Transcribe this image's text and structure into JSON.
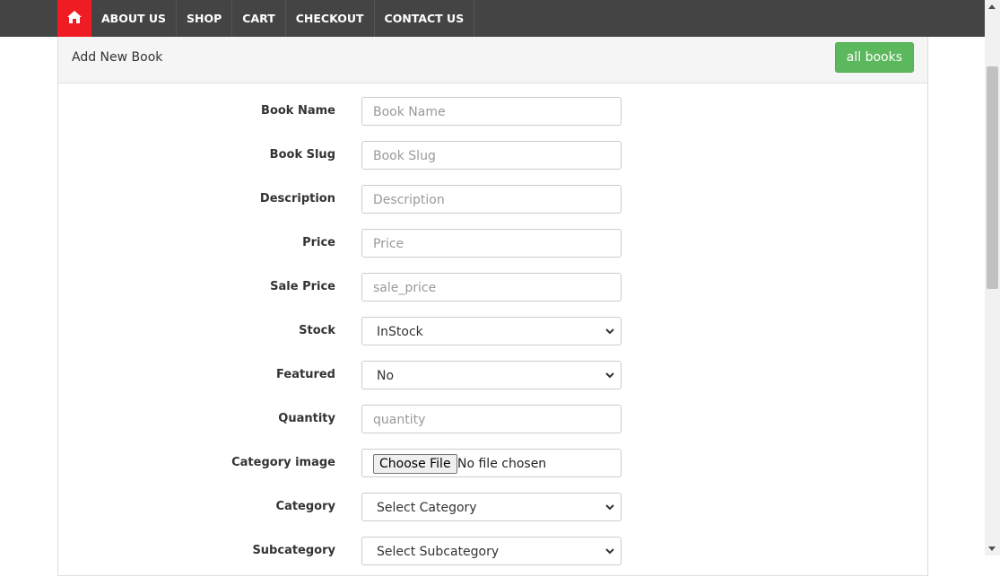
{
  "nav": {
    "home_icon": "home-icon",
    "items": [
      {
        "label": "ABOUT US"
      },
      {
        "label": "SHOP"
      },
      {
        "label": "CART"
      },
      {
        "label": "CHECKOUT"
      },
      {
        "label": "CONTACT US"
      }
    ]
  },
  "panel": {
    "title": "Add New Book",
    "all_books_label": "all books"
  },
  "form": {
    "book_name": {
      "label": "Book Name",
      "placeholder": "Book Name"
    },
    "book_slug": {
      "label": "Book Slug",
      "placeholder": "Book Slug"
    },
    "description": {
      "label": "Description",
      "placeholder": "Description"
    },
    "price": {
      "label": "Price",
      "placeholder": "Price"
    },
    "sale_price": {
      "label": "Sale Price",
      "placeholder": "sale_price"
    },
    "stock": {
      "label": "Stock",
      "value": "InStock"
    },
    "featured": {
      "label": "Featured",
      "value": "No"
    },
    "quantity": {
      "label": "Quantity",
      "placeholder": "quantity"
    },
    "category_image": {
      "label": "Category image",
      "button": "Choose File",
      "status": "No file chosen"
    },
    "category": {
      "label": "Category",
      "value": "Select Category"
    },
    "subcategory": {
      "label": "Subcategory",
      "value": "Select Subcategory"
    }
  },
  "colors": {
    "topbar": "#444444",
    "home_accent": "#ef1c24",
    "success_button": "#5cb85c"
  }
}
